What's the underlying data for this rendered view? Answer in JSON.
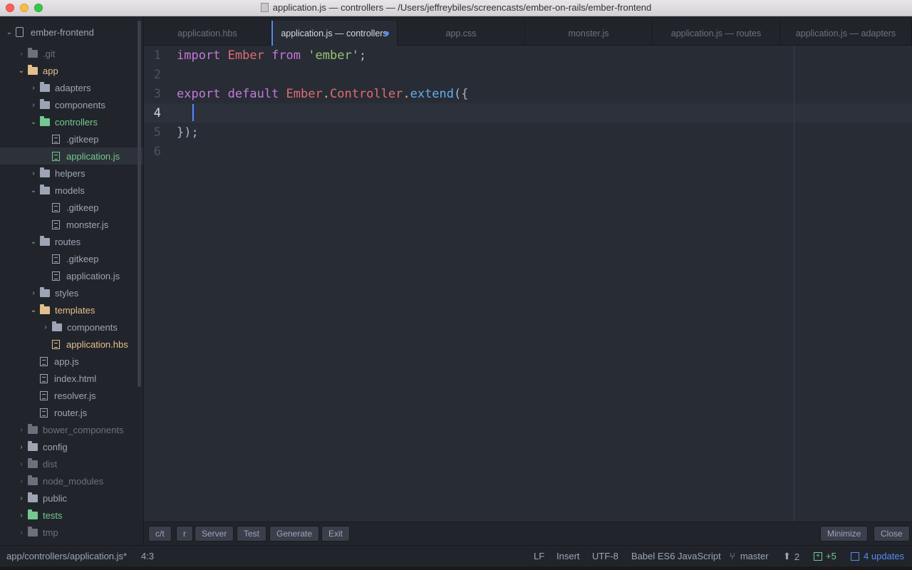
{
  "window": {
    "title": "application.js — controllers — /Users/jeffreybiles/screencasts/ember-on-rails/ember-frontend"
  },
  "tree": {
    "project": "ember-frontend",
    "items": [
      {
        "label": ".git",
        "kind": "folder",
        "expanded": false,
        "style": "dim"
      },
      {
        "label": "app",
        "kind": "folder",
        "expanded": true,
        "style": "orange"
      },
      {
        "label": "adapters",
        "kind": "folder",
        "expanded": false,
        "style": "normal"
      },
      {
        "label": "components",
        "kind": "folder",
        "expanded": false,
        "style": "normal"
      },
      {
        "label": "controllers",
        "kind": "folder",
        "expanded": true,
        "style": "green"
      },
      {
        "label": ".gitkeep",
        "kind": "file",
        "style": "normal"
      },
      {
        "label": "application.js",
        "kind": "file",
        "style": "green",
        "selected": true
      },
      {
        "label": "helpers",
        "kind": "folder",
        "expanded": false,
        "style": "normal"
      },
      {
        "label": "models",
        "kind": "folder",
        "expanded": true,
        "style": "normal"
      },
      {
        "label": ".gitkeep",
        "kind": "file",
        "style": "normal"
      },
      {
        "label": "monster.js",
        "kind": "file",
        "style": "normal"
      },
      {
        "label": "routes",
        "kind": "folder",
        "expanded": true,
        "style": "normal"
      },
      {
        "label": ".gitkeep",
        "kind": "file",
        "style": "normal"
      },
      {
        "label": "application.js",
        "kind": "file",
        "style": "normal"
      },
      {
        "label": "styles",
        "kind": "folder",
        "expanded": false,
        "style": "normal"
      },
      {
        "label": "templates",
        "kind": "folder",
        "expanded": true,
        "style": "orange"
      },
      {
        "label": "components",
        "kind": "folder",
        "expanded": false,
        "style": "normal"
      },
      {
        "label": "application.hbs",
        "kind": "file",
        "style": "orange"
      },
      {
        "label": "app.js",
        "kind": "file",
        "style": "normal"
      },
      {
        "label": "index.html",
        "kind": "file",
        "style": "normal"
      },
      {
        "label": "resolver.js",
        "kind": "file",
        "style": "normal"
      },
      {
        "label": "router.js",
        "kind": "file",
        "style": "normal"
      },
      {
        "label": "bower_components",
        "kind": "folder",
        "expanded": false,
        "style": "dim"
      },
      {
        "label": "config",
        "kind": "folder",
        "expanded": false,
        "style": "normal"
      },
      {
        "label": "dist",
        "kind": "folder",
        "expanded": false,
        "style": "dim"
      },
      {
        "label": "node_modules",
        "kind": "folder",
        "expanded": false,
        "style": "dim"
      },
      {
        "label": "public",
        "kind": "folder",
        "expanded": false,
        "style": "normal"
      },
      {
        "label": "tests",
        "kind": "folder",
        "expanded": false,
        "style": "green"
      },
      {
        "label": "tmp",
        "kind": "folder",
        "expanded": false,
        "style": "dim"
      }
    ]
  },
  "tabs": [
    {
      "label": "application.hbs",
      "active": false
    },
    {
      "label": "application.js — controllers",
      "active": true,
      "modified": true
    },
    {
      "label": "app.css",
      "active": false
    },
    {
      "label": "monster.js",
      "active": false
    },
    {
      "label": "application.js — routes",
      "active": false
    },
    {
      "label": "application.js — adapters",
      "active": false
    }
  ],
  "editor": {
    "line_numbers": [
      "1",
      "2",
      "3",
      "4",
      "5",
      "6"
    ],
    "current_line": "4",
    "lines": [
      [
        {
          "t": "import ",
          "c": "kw"
        },
        {
          "t": "Ember ",
          "c": "cls"
        },
        {
          "t": "from ",
          "c": "kw"
        },
        {
          "t": "'ember'",
          "c": "str"
        },
        {
          "t": ";",
          "c": "pl"
        }
      ],
      [],
      [
        {
          "t": "export ",
          "c": "kw"
        },
        {
          "t": "default ",
          "c": "kw"
        },
        {
          "t": "Ember",
          "c": "cls"
        },
        {
          "t": ".",
          "c": "cy"
        },
        {
          "t": "Controller",
          "c": "cls"
        },
        {
          "t": ".",
          "c": "cy"
        },
        {
          "t": "extend",
          "c": "fn"
        },
        {
          "t": "({",
          "c": "pl"
        }
      ],
      [],
      [
        {
          "t": "});",
          "c": "pl"
        }
      ],
      []
    ]
  },
  "tool_buttons": [
    "c/t",
    "r",
    "Server",
    "Test",
    "Generate",
    "Exit"
  ],
  "panel_buttons": {
    "minimize": "Minimize",
    "close": "Close"
  },
  "status": {
    "path": "app/controllers/application.js*",
    "cursor": "4:3",
    "line_ending": "LF",
    "mode": "Insert",
    "encoding": "UTF-8",
    "grammar": "Babel ES6 JavaScript",
    "branch": "master",
    "ahead": "2",
    "added": "+5",
    "updates": "4 updates"
  },
  "colors": {
    "accent": "#568af2",
    "green": "#73c990",
    "orange": "#e2c08d"
  }
}
